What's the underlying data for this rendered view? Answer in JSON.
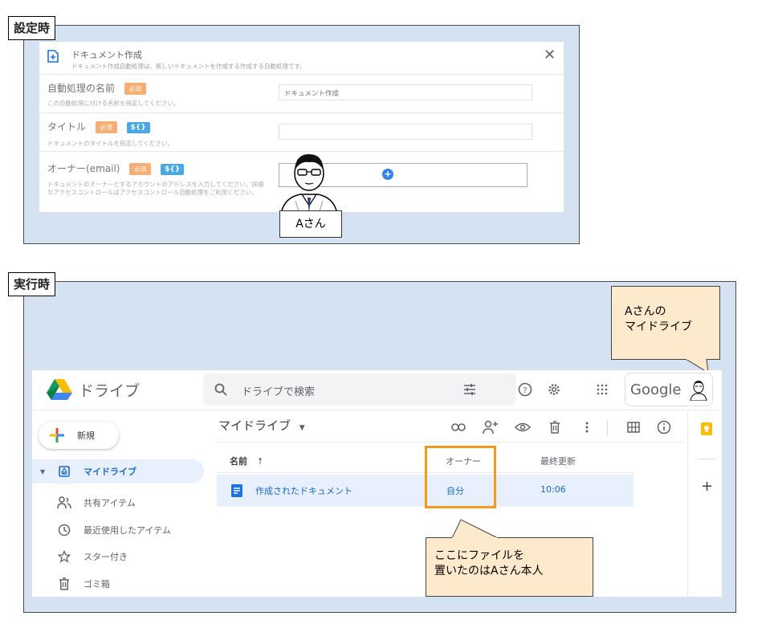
{
  "settings_section": {
    "label": "設定時",
    "dialog": {
      "title": "ドキュメント作成",
      "subtitle": "ドキュメント作成自動処理は、新しいドキュメントを作成する作成する自動処理です。",
      "close_glyph": "✕",
      "fields": [
        {
          "label": "自動処理の名前",
          "badges": [
            "必須"
          ],
          "description": "この自動処理に付ける名前を指定してください。",
          "value": "ドキュメント作成"
        },
        {
          "label": "タイトル",
          "badges": [
            "必須",
            "${}"
          ],
          "description": "ドキュメントのタイトルを指定してください。",
          "value": ""
        },
        {
          "label": "オーナー(email)",
          "badges": [
            "必須",
            "${}"
          ],
          "description": "ドキュメントのオーナーとするアカウントのアドレスを入力してください。詳細なアクセスコントロールはアクセスコントロール自動処理をご利用ください。",
          "value": "",
          "add_glyph": "+"
        }
      ]
    },
    "person_tag": "Aさん"
  },
  "runtime_section": {
    "label": "実行時",
    "callout_top": {
      "line1": "Aさんの",
      "line2": "マイドライブ"
    },
    "callout_bottom": {
      "line1": "ここにファイルを",
      "line2": "置いたのはAさん本人"
    },
    "drive": {
      "app_name": "ドライブ",
      "search_placeholder": "ドライブで検索",
      "google_label": "Google",
      "new_button": "新規",
      "location_title": "マイドライブ",
      "sidebar": [
        {
          "label": "マイドライブ",
          "icon": "my-drive-icon"
        },
        {
          "label": "共有アイテム",
          "icon": "shared-icon"
        },
        {
          "label": "最近使用したアイテム",
          "icon": "recent-icon"
        },
        {
          "label": "スター付き",
          "icon": "star-icon"
        },
        {
          "label": "ゴミ箱",
          "icon": "trash-icon"
        }
      ],
      "columns": {
        "name": "名前",
        "sort_arrow": "↑",
        "owner": "オーナー",
        "modified": "最終更新"
      },
      "files": [
        {
          "name": "作成されたドキュメント",
          "owner": "自分",
          "modified": "10:06"
        }
      ],
      "right_panel_plus": "+",
      "colors": {
        "accent_blue": "#1967d2",
        "selected_row": "#e8f0fe",
        "highlight_border": "#f29a1c",
        "callout_fill": "#fde9cb",
        "panel_bg": "#d5e2f2"
      }
    }
  }
}
